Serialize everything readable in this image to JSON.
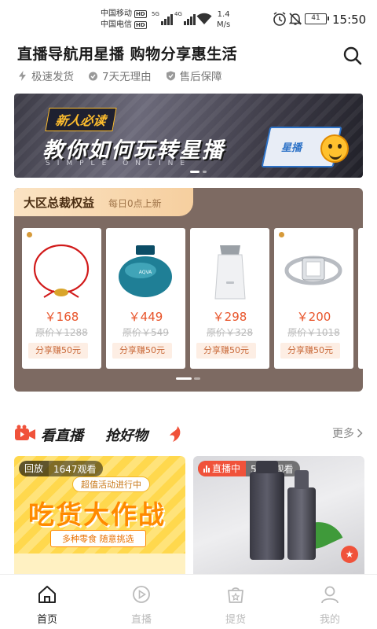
{
  "status_bar": {
    "carrier_1": "中国移动",
    "carrier_2": "中国电信",
    "hd_label": "HD",
    "net_1": "5G",
    "net_2": "4G",
    "speed_value": "1.4",
    "speed_unit": "M/s",
    "battery": "41",
    "time": "15:50",
    "icons": [
      "alarm-icon",
      "mute-icon",
      "wifi-icon"
    ]
  },
  "header": {
    "headline": "直播导航用星播 购物分享惠生活",
    "badges": [
      {
        "icon": "lightning-icon",
        "label": "极速发货"
      },
      {
        "icon": "return-icon",
        "label": "7天无理由"
      },
      {
        "icon": "shield-icon",
        "label": "售后保障"
      }
    ]
  },
  "banner": {
    "tag": "新人必读",
    "title": "教你如何玩转星播",
    "subtitle": "SIMPLE ONLINE",
    "book_label": "星播",
    "page_count": 2,
    "active_page": 1
  },
  "rights": {
    "title": "大区总裁权益",
    "subtitle": "每日0点上新",
    "products": [
      {
        "name": "red-string-bracelet",
        "price": "￥168",
        "original": "原价￥1288",
        "share": "分享赚50元",
        "has_logo": true
      },
      {
        "name": "aqua-perfume",
        "price": "￥449",
        "original": "原价￥549",
        "share": "分享赚50元",
        "has_logo": false
      },
      {
        "name": "white-humidifier",
        "price": "￥298",
        "original": "原价￥328",
        "share": "分享赚50元",
        "has_logo": false
      },
      {
        "name": "diamond-ring",
        "price": "￥200",
        "original": "原价￥1018",
        "share": "分享赚50元",
        "has_logo": true
      }
    ]
  },
  "live": {
    "title_1": "看直播",
    "title_2": "抢好物",
    "more": "更多",
    "streams": [
      {
        "state": "回放",
        "views": "1647观看",
        "top_text": "超值活动进行中",
        "big_text": "吃货大作战",
        "bottom_text": "多种零食 随意挑选"
      },
      {
        "state": "直播中",
        "views": "5961观看"
      }
    ]
  },
  "tabbar": [
    {
      "label": "首页",
      "icon": "home-icon",
      "active": true
    },
    {
      "label": "直播",
      "icon": "live-play-icon",
      "active": false
    },
    {
      "label": "提货",
      "icon": "pickup-bag-icon",
      "active": false
    },
    {
      "label": "我的",
      "icon": "profile-icon",
      "active": false
    }
  ],
  "colors": {
    "accent": "#e8542a",
    "panel_bg": "#7d6a62",
    "tab_gold": "#f6cf9f",
    "live_red": "#f0523a"
  }
}
